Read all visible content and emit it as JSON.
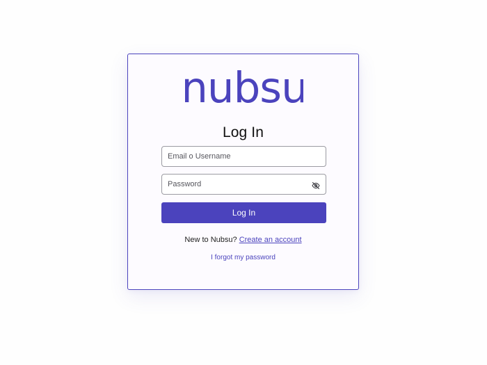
{
  "brand": {
    "logo_text": "nubsu",
    "accent_color": "#4b43bd"
  },
  "login": {
    "title": "Log In",
    "email_placeholder": "Email o Username",
    "email_value": "",
    "password_placeholder": "Password",
    "password_value": "",
    "password_toggle_icon": "eye-off-icon",
    "submit_label": "Log In"
  },
  "signup": {
    "prompt": "New to Nubsu?",
    "link_label": "Create an account"
  },
  "forgot": {
    "link_label": "I forgot my password"
  }
}
